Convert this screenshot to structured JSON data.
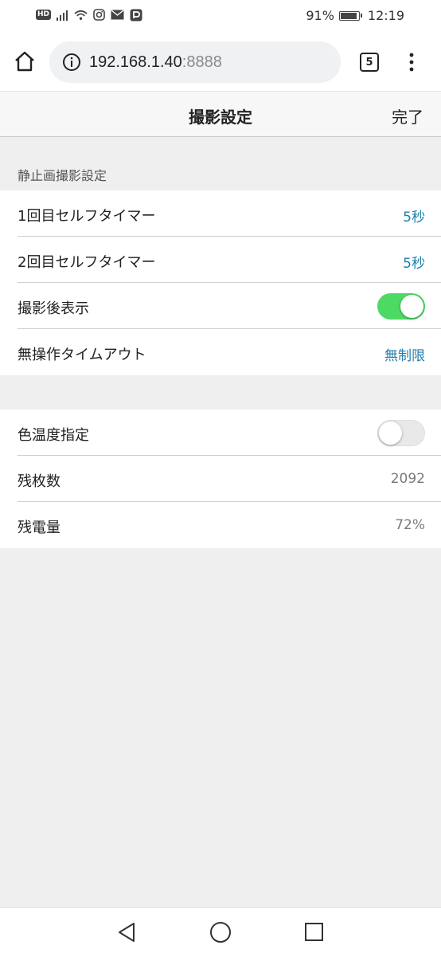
{
  "status_bar": {
    "hd_badge": "HD",
    "battery_percent": "91%",
    "battery_level": 0.91,
    "time": "12:19",
    "icons": [
      "hd-icon",
      "signal-icon",
      "wifi-icon",
      "instagram-icon",
      "mail-icon",
      "paypay-icon",
      "battery-icon"
    ]
  },
  "browser": {
    "url_host": "192.168.1.40",
    "url_port": ":8888",
    "tab_count": "5"
  },
  "header": {
    "title": "撮影設定",
    "done_label": "完了"
  },
  "still_section": {
    "label": "静止画撮影設定",
    "rows": [
      {
        "label": "1回目セルフタイマー",
        "value": "5秒"
      },
      {
        "label": "2回目セルフタイマー",
        "value": "5秒"
      },
      {
        "label": "撮影後表示",
        "toggle": true
      },
      {
        "label": "無操作タイムアウト",
        "value": "無制限"
      }
    ]
  },
  "other_section": {
    "rows": [
      {
        "label": "色温度指定",
        "toggle": false
      },
      {
        "label": "残枚数",
        "value": "2092"
      },
      {
        "label": "残電量",
        "value": "72%"
      }
    ]
  },
  "colors": {
    "accent_blue": "#1f7fae",
    "toggle_on": "#4cd964",
    "toggle_off": "#e9e9e9",
    "background": "#efefef"
  }
}
